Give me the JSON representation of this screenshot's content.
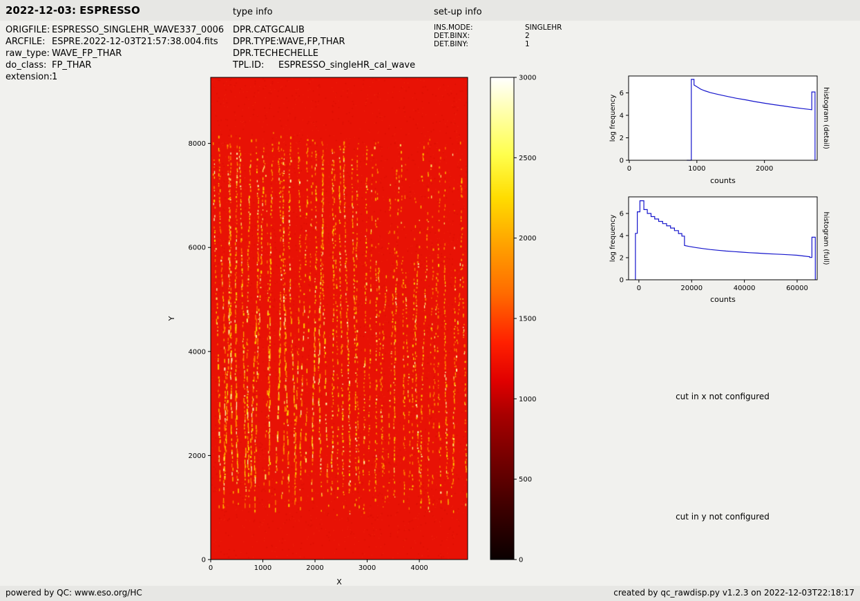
{
  "page": {
    "title": "2022-12-03: ESPRESSO",
    "section_headings": {
      "type_info": "type info",
      "setup_info": "set-up info"
    },
    "footer": {
      "left": "powered by QC: www.eso.org/HC",
      "right": "created by qc_rawdisp.py v1.2.3 on 2022-12-03T22:18:17"
    },
    "colors": {
      "background": "#f1f1ee",
      "band": "#e7e7e4",
      "text": "#000000",
      "hist_line": "#1414cc"
    }
  },
  "file_info": {
    "rows": [
      {
        "label": "ORIGFILE:",
        "value": "ESPRESSO_SINGLEHR_WAVE337_0006"
      },
      {
        "label": "ARCFILE:",
        "value": "ESPRE.2022-12-03T21:57:38.004.fits"
      },
      {
        "label": "raw_type:",
        "value": "WAVE_FP_THAR"
      },
      {
        "label": "do_class:",
        "value": "FP_THAR"
      },
      {
        "label": "extension:",
        "value": "1"
      }
    ]
  },
  "type_info": {
    "rows": [
      {
        "label": "DPR.CATG:",
        "value": "CALIB"
      },
      {
        "label": "DPR.TYPE:",
        "value": "WAVE,FP,THAR"
      },
      {
        "label": "DPR.TECH:",
        "value": "ECHELLE"
      },
      {
        "label": "TPL.ID:",
        "value": "ESPRESSO_singleHR_cal_wave"
      }
    ]
  },
  "setup_info": {
    "rows": [
      {
        "label": "INS.MODE:",
        "value": "SINGLEHR"
      },
      {
        "label": "DET.BINX:",
        "value": "2"
      },
      {
        "label": "DET.BINY:",
        "value": "1"
      }
    ]
  },
  "messages": {
    "cut_x": "cut in x not configured",
    "cut_y": "cut in y not configured"
  },
  "chart_data": [
    {
      "type": "heatmap",
      "name": "raw-image-display",
      "description": "raw echelle FP/ThAr calibration frame: bright red background with dense wavy vertical columns of yellow emission spots between y~800 and y~8300",
      "xlabel": "X",
      "ylabel": "Y",
      "xlim": [
        0,
        4926
      ],
      "ylim": [
        0,
        9270
      ],
      "xticks": [
        0,
        1000,
        2000,
        3000,
        4000
      ],
      "yticks": [
        0,
        2000,
        4000,
        6000,
        8000
      ],
      "base_color": "#e81205",
      "speckle_palette": [
        "#ff7b00",
        "#ffa600",
        "#ffd000",
        "#ffe960",
        "#fffba8"
      ],
      "bright_band_y": [
        800,
        8300
      ],
      "n_order_columns": 46,
      "colorbar": {
        "colormap": "hot",
        "range": [
          0,
          3000
        ],
        "ticks": [
          0,
          500,
          1000,
          1500,
          2000,
          2500,
          3000
        ],
        "stops": [
          {
            "at": 0,
            "color": "#0a0000"
          },
          {
            "at": 0.1,
            "color": "#3a0000"
          },
          {
            "at": 0.2,
            "color": "#700000"
          },
          {
            "at": 0.3,
            "color": "#a80000"
          },
          {
            "at": 0.37,
            "color": "#e00000"
          },
          {
            "at": 0.45,
            "color": "#ff2000"
          },
          {
            "at": 0.55,
            "color": "#ff6a00"
          },
          {
            "at": 0.65,
            "color": "#ffa000"
          },
          {
            "at": 0.75,
            "color": "#ffdc00"
          },
          {
            "at": 0.84,
            "color": "#ffff4d"
          },
          {
            "at": 0.93,
            "color": "#ffffae"
          },
          {
            "at": 1,
            "color": "#ffffff"
          }
        ]
      }
    },
    {
      "type": "line",
      "name": "histogram-detail",
      "right_label": "histogram (detail)",
      "xlabel": "counts",
      "ylabel": "log frequency",
      "xlim": [
        -10,
        2780
      ],
      "ylim": [
        0,
        7.5
      ],
      "xticks": [
        0,
        1000,
        2000
      ],
      "yticks": [
        0,
        2,
        4,
        6
      ],
      "line_color": "#1414cc",
      "points": [
        [
          850,
          0
        ],
        [
          918,
          0
        ],
        [
          918,
          7.2
        ],
        [
          958,
          7.2
        ],
        [
          958,
          6.7
        ],
        [
          1000,
          6.55
        ],
        [
          1060,
          6.32
        ],
        [
          1120,
          6.18
        ],
        [
          1200,
          6.02
        ],
        [
          1320,
          5.85
        ],
        [
          1450,
          5.68
        ],
        [
          1580,
          5.52
        ],
        [
          1720,
          5.38
        ],
        [
          1860,
          5.22
        ],
        [
          2000,
          5.08
        ],
        [
          2140,
          4.95
        ],
        [
          2280,
          4.83
        ],
        [
          2420,
          4.71
        ],
        [
          2560,
          4.6
        ],
        [
          2660,
          4.53
        ],
        [
          2700,
          4.5
        ],
        [
          2700,
          6.08
        ],
        [
          2748,
          6.08
        ],
        [
          2748,
          0
        ]
      ]
    },
    {
      "type": "line",
      "name": "histogram-full",
      "right_label": "histogram (full)",
      "xlabel": "counts",
      "ylabel": "log frequency",
      "xlim": [
        -3900,
        67600
      ],
      "ylim": [
        0,
        7.5
      ],
      "xticks": [
        0,
        20000,
        40000,
        60000
      ],
      "yticks": [
        0,
        2,
        4,
        6
      ],
      "line_color": "#1414cc",
      "points": [
        [
          -1300,
          0
        ],
        [
          -1300,
          4.2
        ],
        [
          -600,
          4.2
        ],
        [
          -600,
          6.15
        ],
        [
          400,
          6.15
        ],
        [
          400,
          7.15
        ],
        [
          1900,
          7.15
        ],
        [
          1900,
          6.35
        ],
        [
          3200,
          6.35
        ],
        [
          3200,
          6.0
        ],
        [
          4600,
          6.0
        ],
        [
          4600,
          5.72
        ],
        [
          6000,
          5.72
        ],
        [
          6000,
          5.5
        ],
        [
          7500,
          5.5
        ],
        [
          7500,
          5.28
        ],
        [
          9000,
          5.28
        ],
        [
          9000,
          5.08
        ],
        [
          10500,
          5.08
        ],
        [
          10500,
          4.88
        ],
        [
          12000,
          4.88
        ],
        [
          12000,
          4.68
        ],
        [
          13500,
          4.68
        ],
        [
          13500,
          4.45
        ],
        [
          15000,
          4.45
        ],
        [
          15000,
          4.18
        ],
        [
          16300,
          4.18
        ],
        [
          16300,
          3.95
        ],
        [
          17300,
          3.95
        ],
        [
          17300,
          3.1
        ],
        [
          19000,
          3.02
        ],
        [
          21500,
          2.92
        ],
        [
          24000,
          2.83
        ],
        [
          27000,
          2.74
        ],
        [
          30000,
          2.67
        ],
        [
          33000,
          2.6
        ],
        [
          36000,
          2.55
        ],
        [
          39000,
          2.5
        ],
        [
          42000,
          2.45
        ],
        [
          45000,
          2.41
        ],
        [
          48000,
          2.37
        ],
        [
          51000,
          2.33
        ],
        [
          54000,
          2.3
        ],
        [
          57000,
          2.26
        ],
        [
          60000,
          2.22
        ],
        [
          62500,
          2.15
        ],
        [
          64800,
          2.08
        ],
        [
          64800,
          2.02
        ],
        [
          65600,
          2.02
        ],
        [
          65600,
          3.85
        ],
        [
          66900,
          3.85
        ],
        [
          66900,
          0
        ]
      ]
    }
  ]
}
